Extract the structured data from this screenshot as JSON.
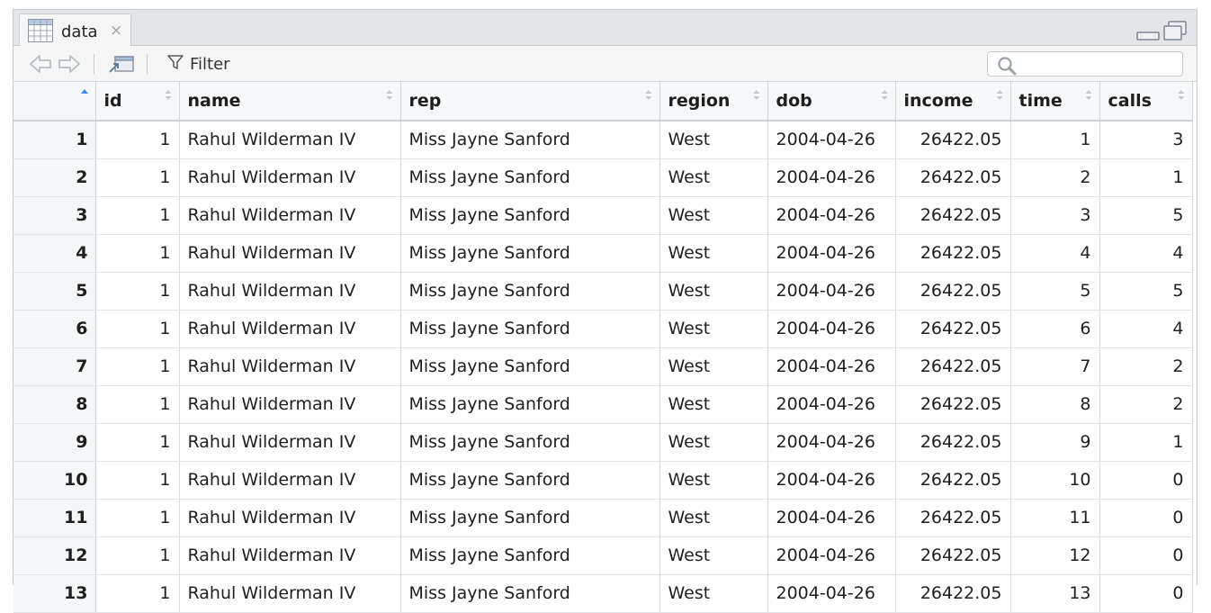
{
  "tab": {
    "label": "data",
    "close": "×"
  },
  "toolbar": {
    "filter_label": "Filter"
  },
  "search": {
    "placeholder": "",
    "value": ""
  },
  "table": {
    "sorted_column": "",
    "sort_direction": "asc",
    "columns": [
      "",
      "id",
      "name",
      "rep",
      "region",
      "dob",
      "income",
      "time",
      "calls"
    ],
    "rows": [
      [
        "1",
        "1",
        "Rahul Wilderman IV",
        "Miss Jayne Sanford",
        "West",
        "2004-04-26",
        "26422.05",
        "1",
        "3"
      ],
      [
        "2",
        "1",
        "Rahul Wilderman IV",
        "Miss Jayne Sanford",
        "West",
        "2004-04-26",
        "26422.05",
        "2",
        "1"
      ],
      [
        "3",
        "1",
        "Rahul Wilderman IV",
        "Miss Jayne Sanford",
        "West",
        "2004-04-26",
        "26422.05",
        "3",
        "5"
      ],
      [
        "4",
        "1",
        "Rahul Wilderman IV",
        "Miss Jayne Sanford",
        "West",
        "2004-04-26",
        "26422.05",
        "4",
        "4"
      ],
      [
        "5",
        "1",
        "Rahul Wilderman IV",
        "Miss Jayne Sanford",
        "West",
        "2004-04-26",
        "26422.05",
        "5",
        "5"
      ],
      [
        "6",
        "1",
        "Rahul Wilderman IV",
        "Miss Jayne Sanford",
        "West",
        "2004-04-26",
        "26422.05",
        "6",
        "4"
      ],
      [
        "7",
        "1",
        "Rahul Wilderman IV",
        "Miss Jayne Sanford",
        "West",
        "2004-04-26",
        "26422.05",
        "7",
        "2"
      ],
      [
        "8",
        "1",
        "Rahul Wilderman IV",
        "Miss Jayne Sanford",
        "West",
        "2004-04-26",
        "26422.05",
        "8",
        "2"
      ],
      [
        "9",
        "1",
        "Rahul Wilderman IV",
        "Miss Jayne Sanford",
        "West",
        "2004-04-26",
        "26422.05",
        "9",
        "1"
      ],
      [
        "10",
        "1",
        "Rahul Wilderman IV",
        "Miss Jayne Sanford",
        "West",
        "2004-04-26",
        "26422.05",
        "10",
        "0"
      ],
      [
        "11",
        "1",
        "Rahul Wilderman IV",
        "Miss Jayne Sanford",
        "West",
        "2004-04-26",
        "26422.05",
        "11",
        "0"
      ],
      [
        "12",
        "1",
        "Rahul Wilderman IV",
        "Miss Jayne Sanford",
        "West",
        "2004-04-26",
        "26422.05",
        "12",
        "0"
      ],
      [
        "13",
        "1",
        "Rahul Wilderman IV",
        "Miss Jayne Sanford",
        "West",
        "2004-04-26",
        "26422.05",
        "13",
        "0"
      ]
    ]
  },
  "icons": {
    "tab": "grid-icon",
    "back": "back-arrow-icon",
    "forward": "forward-arrow-icon",
    "popout": "popout-icon",
    "filter": "filter-icon",
    "search": "search-icon",
    "minimize": "minimize-icon",
    "maximize": "maximize-icon"
  },
  "colors": {
    "sort_indicator": "#3a8ee6",
    "frame": "#e3e5e7"
  }
}
